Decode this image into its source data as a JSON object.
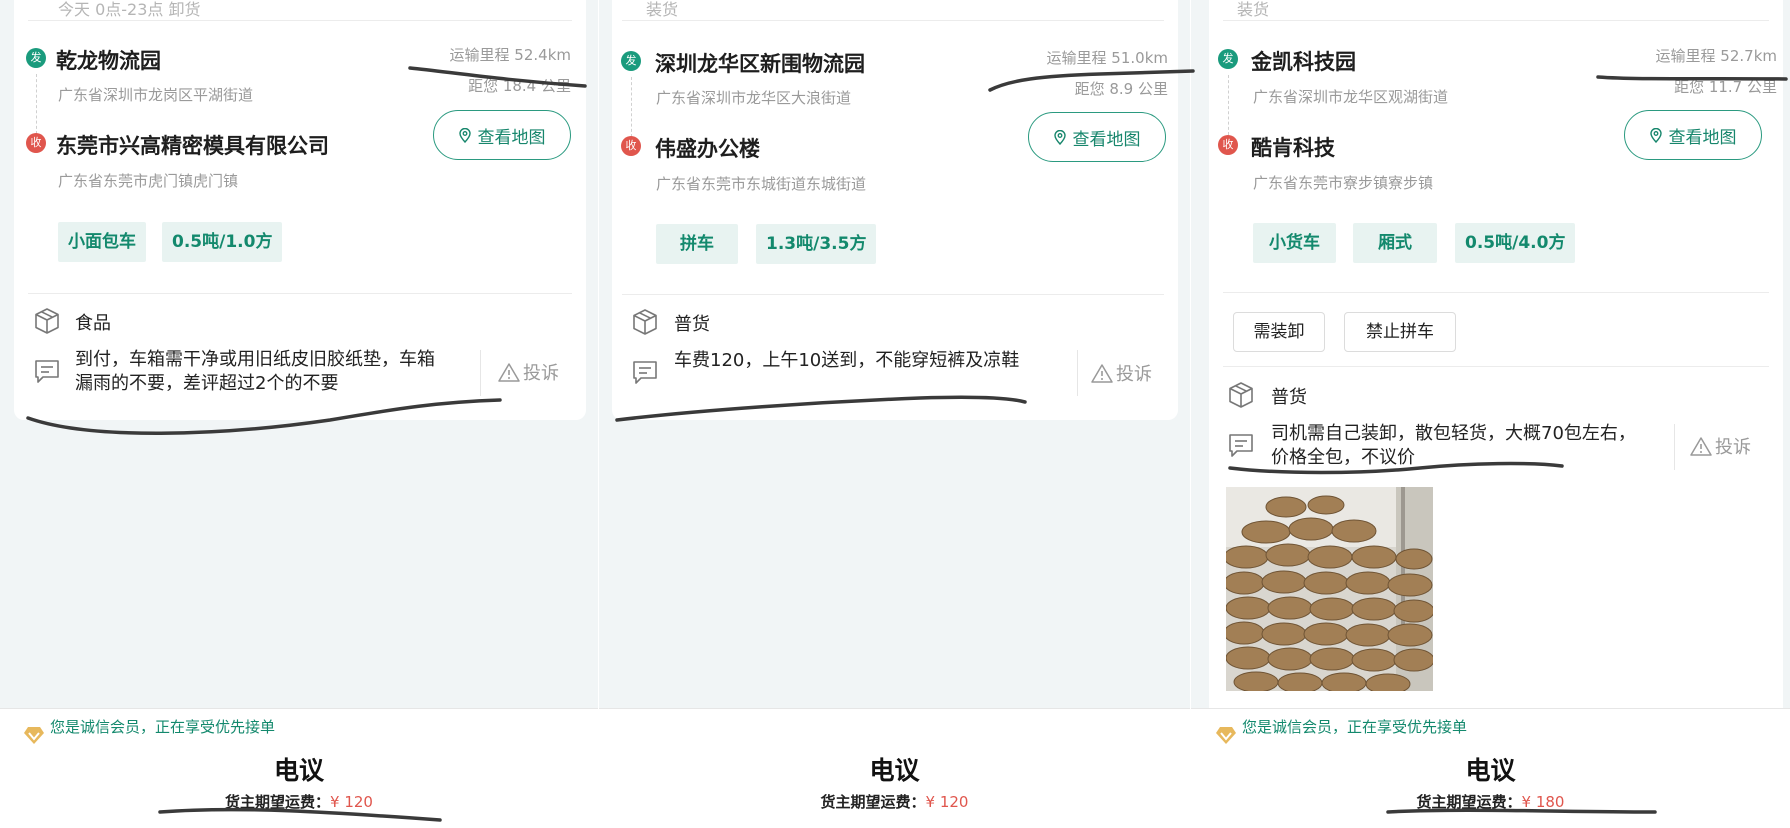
{
  "panels": [
    {
      "top_text": "今天 0点-23点 卸货",
      "sender": {
        "badge": "发",
        "name": "乾龙物流园",
        "address": "广东省深圳市龙岗区平湖街道"
      },
      "receiver": {
        "badge": "收",
        "name": "东莞市兴高精密模具有限公司",
        "address": "广东省东莞市虎门镇虎门镇"
      },
      "mileage": "运输里程 52.4km",
      "distance": "距您 18.4 公里",
      "map_button": "查看地图",
      "tags": [
        "小面包车",
        "0.5吨/1.0方"
      ],
      "cargo": "食品",
      "note": "到付，车箱需干净或用旧纸皮旧胶纸垫，车箱漏雨的不要，差评超过2个的不要",
      "complain": "投诉",
      "member_text": "您是诚信会员，正在享受优先接单",
      "price_mode": "电议",
      "freight_label": "货主期望运费：",
      "freight_price": "¥ 120"
    },
    {
      "top_text": "装货",
      "sender": {
        "badge": "发",
        "name": "深圳龙华区新围物流园",
        "address": "广东省深圳市龙华区大浪街道"
      },
      "receiver": {
        "badge": "收",
        "name": "伟盛办公楼",
        "address": "广东省东莞市东城街道东城街道"
      },
      "mileage": "运输里程 51.0km",
      "distance": "距您 8.9 公里",
      "map_button": "查看地图",
      "tags": [
        "拼车",
        "1.3吨/3.5方"
      ],
      "cargo": "普货",
      "note": "车费120，上午10送到，不能穿短裤及凉鞋",
      "complain": "投诉",
      "price_mode": "电议",
      "freight_label": "货主期望运费：",
      "freight_price": "¥ 120"
    },
    {
      "top_text": "装货",
      "sender": {
        "badge": "发",
        "name": "金凯科技园",
        "address": "广东省深圳市龙华区观湖街道"
      },
      "receiver": {
        "badge": "收",
        "name": "酷肯科技",
        "address": "广东省东莞市寮步镇寮步镇"
      },
      "mileage": "运输里程 52.7km",
      "distance": "距您 11.7 公里",
      "map_button": "查看地图",
      "tags": [
        "小货车",
        "厢式",
        "0.5吨/4.0方"
      ],
      "options": [
        "需装卸",
        "禁止拼车"
      ],
      "cargo": "普货",
      "note": "司机需自己装卸，散包轻货，大概70包左右，价格全包，不议价",
      "complain": "投诉",
      "member_text": "您是诚信会员，正在享受优先接单",
      "price_mode": "电议",
      "freight_label": "货主期望运费：",
      "freight_price": "¥ 180"
    }
  ],
  "colors": {
    "accent_green": "#1a9b7d",
    "receive_red": "#e0564d",
    "background": "#f1f5f6"
  },
  "icons": [
    "send-badge",
    "receive-badge",
    "location-pin-icon",
    "box-icon",
    "message-icon",
    "warning-icon",
    "vip-heart-icon"
  ]
}
